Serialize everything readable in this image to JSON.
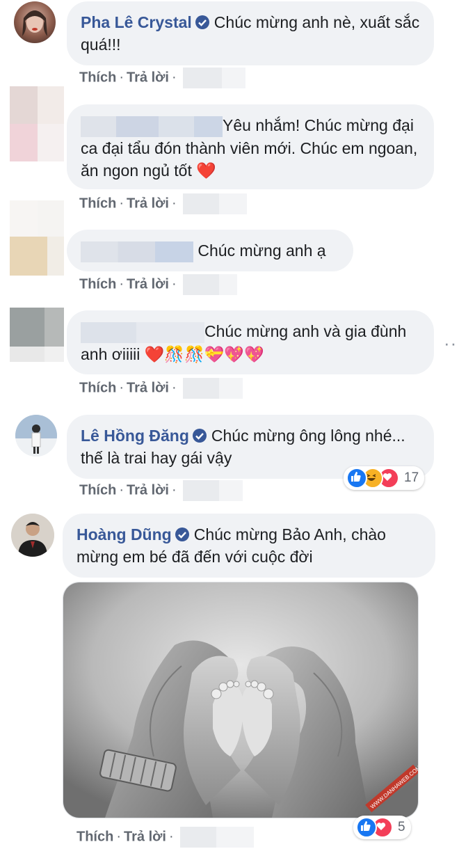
{
  "comments": [
    {
      "author": "Pha Lê Crystal",
      "text": "Chúc mừng anh nè, xuất sắc quá!!!",
      "actions": {
        "like": "Thích",
        "reply": "Trả lời"
      }
    },
    {
      "author": "",
      "text": "Yêu nhắm! Chúc mừng đại ca đại tẩu đón thành viên mới. Chúc em ngoan, ăn ngon ngủ tốt",
      "emoji": "❤️",
      "actions": {
        "like": "Thích",
        "reply": "Trả lời"
      }
    },
    {
      "author": "",
      "text": "Chúc mừng anh ạ",
      "actions": {
        "like": "Thích",
        "reply": "Trả lời"
      }
    },
    {
      "author": "",
      "text": "Chúc mừng anh và gia đùnh anh ơiiiii",
      "emoji": "❤️🎊🎊💝💖💖",
      "actions": {
        "like": "Thích",
        "reply": "Trả lời"
      }
    },
    {
      "author": "Lê Hồng Đăng",
      "text": "Chúc mừng ông lông nhé... thế là trai hay gái vậy",
      "reactions": {
        "count": "17",
        "icons": [
          "like-icon",
          "haha-icon",
          "love-icon"
        ]
      },
      "actions": {
        "like": "Thích",
        "reply": "Trả lời"
      }
    },
    {
      "author": "Hoàng Dũng",
      "text": "Chúc mừng Bảo Anh, chào mừng em bé đã đến với cuộc đời",
      "image": {
        "alt": "black-and-white photo of hands forming a heart around a baby's feet",
        "watermark": "WWW.DANHAWEB.COM"
      },
      "reactions": {
        "count": "5",
        "icons": [
          "like-icon",
          "love-icon"
        ]
      },
      "actions": {
        "like": "Thích",
        "reply": "Trả lời"
      }
    }
  ],
  "colors": {
    "name": "#385898",
    "bubble": "#f0f2f5",
    "like": "#1877f2",
    "love": "#f33e58",
    "haha": "#f7b125"
  }
}
